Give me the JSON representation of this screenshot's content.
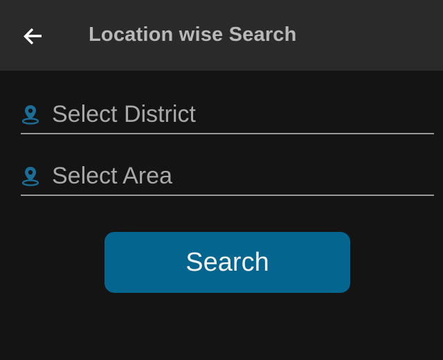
{
  "header": {
    "title": "Location wise Search",
    "back_icon": "arrow-left-icon"
  },
  "form": {
    "district": {
      "placeholder": "Select District",
      "icon": "map-pin-icon"
    },
    "area": {
      "placeholder": "Select Area",
      "icon": "map-pin-icon"
    },
    "search_label": "Search"
  },
  "colors": {
    "background": "#141414",
    "toolbar": "#2a2a2a",
    "accent": "#04668f",
    "pin": "#1a6f98"
  }
}
